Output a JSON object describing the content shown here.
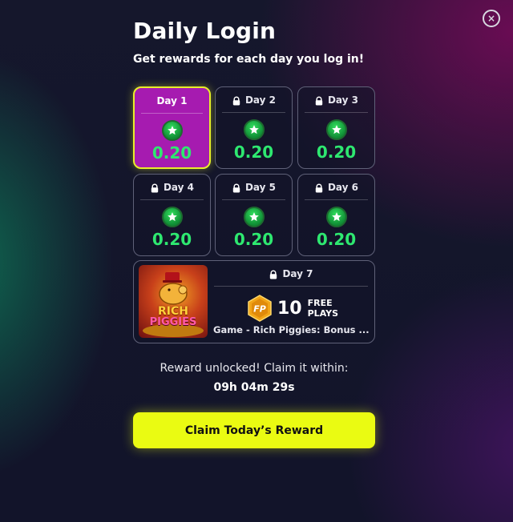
{
  "modal": {
    "title": "Daily Login",
    "subtitle": "Get rewards for each day you log in!",
    "close_label": "×"
  },
  "days": [
    {
      "label": "Day 1",
      "amount": "0.20",
      "locked": false,
      "active": true
    },
    {
      "label": "Day 2",
      "amount": "0.20",
      "locked": true,
      "active": false
    },
    {
      "label": "Day 3",
      "amount": "0.20",
      "locked": true,
      "active": false
    },
    {
      "label": "Day 4",
      "amount": "0.20",
      "locked": true,
      "active": false
    },
    {
      "label": "Day 5",
      "amount": "0.20",
      "locked": true,
      "active": false
    },
    {
      "label": "Day 6",
      "amount": "0.20",
      "locked": true,
      "active": false
    }
  ],
  "day7": {
    "label": "Day 7",
    "locked": true,
    "badge_text": "FP",
    "count": "10",
    "free_label": "FREE",
    "plays_label": "PLAYS",
    "game_name": "Game - Rich Piggies: Bonus ...",
    "thumb_title_a": "RICH",
    "thumb_title_b": "PIGGIES"
  },
  "status": {
    "unlock_text": "Reward unlocked! Claim it within:",
    "timer": "09h 04m 29s"
  },
  "claim_button": "Claim Today’s Reward",
  "colors": {
    "accent_yellow": "#eafb12",
    "active_tile": "#a61bb0",
    "amount_green": "#2ee870"
  }
}
